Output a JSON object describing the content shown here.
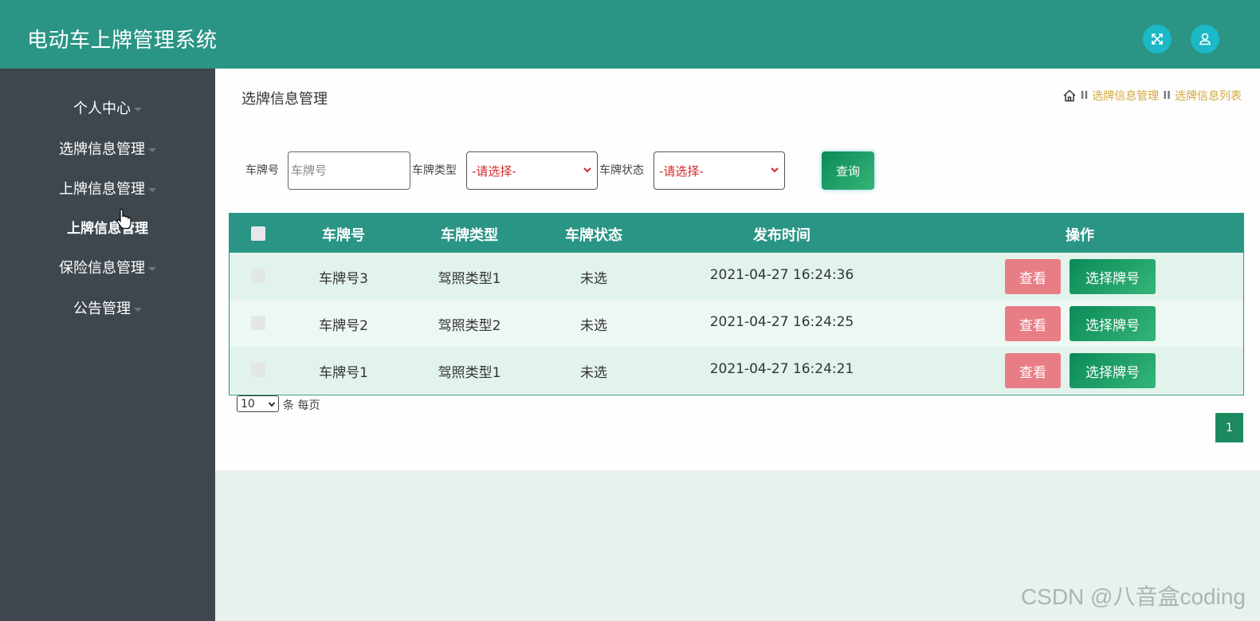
{
  "app": {
    "title": "电动车上牌管理系统"
  },
  "topbar": {
    "fullscreen_icon": "expand-icon",
    "user_icon": "user-icon",
    "icon_color": "#1cb8c8"
  },
  "sidebar": {
    "items": [
      {
        "label": "个人中心"
      },
      {
        "label": "选牌信息管理"
      },
      {
        "label": "上牌信息管理"
      },
      {
        "label": "上牌信息管理"
      },
      {
        "label": "保险信息管理"
      },
      {
        "label": "公告管理"
      }
    ]
  },
  "page": {
    "title": "选牌信息管理",
    "breadcrumb": {
      "separator": "II",
      "items": [
        "选牌信息管理",
        "选牌信息列表"
      ]
    }
  },
  "search": {
    "plate_label": "车牌号",
    "plate_placeholder": "车牌号",
    "type_label": "车牌类型",
    "type_value": "-请选择-",
    "status_label": "车牌状态",
    "status_value": "-请选择-",
    "query_label": "查询"
  },
  "table": {
    "headers": [
      "车牌号",
      "车牌类型",
      "车牌状态",
      "发布时间",
      "操作"
    ],
    "rows": [
      {
        "plate": "车牌号3",
        "type": "驾照类型1",
        "status": "未选",
        "time": "2021-04-27 16:24:36",
        "view": "查看",
        "choose": "选择牌号"
      },
      {
        "plate": "车牌号2",
        "type": "驾照类型2",
        "status": "未选",
        "time": "2021-04-27 16:24:25",
        "view": "查看",
        "choose": "选择牌号"
      },
      {
        "plate": "车牌号1",
        "type": "驾照类型1",
        "status": "未选",
        "time": "2021-04-27 16:24:21",
        "view": "查看",
        "choose": "选择牌号"
      }
    ]
  },
  "pagination": {
    "page_size": "10",
    "page_size_label": "条 每页",
    "current_page": "1"
  },
  "colors": {
    "header": "#2a9585",
    "sidebar": "#3e464e",
    "view_button": "#e97d86",
    "choose_button": "#1c8a5e",
    "breadcrumb": "#d4a83f"
  },
  "watermark": "CSDN @八音盒coding"
}
